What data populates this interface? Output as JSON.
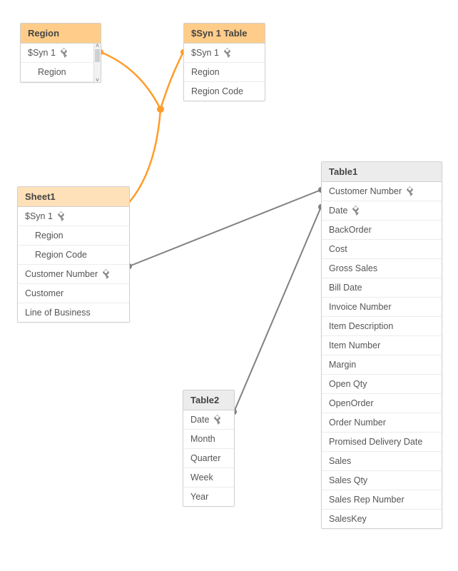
{
  "colors": {
    "orange_link": "#ff9c2a",
    "grey_link": "#808080",
    "header_orange": "#ffcd89",
    "header_orange_light": "#ffe1b9",
    "header_grey": "#ececec"
  },
  "nodes": {
    "region": {
      "title": "Region",
      "fields": [
        {
          "label": "$Syn 1",
          "key": true
        },
        {
          "label": "Region",
          "indent": true
        }
      ]
    },
    "syn1table": {
      "title": "$Syn 1 Table",
      "fields": [
        {
          "label": "$Syn 1",
          "key": true
        },
        {
          "label": "Region"
        },
        {
          "label": "Region Code"
        }
      ]
    },
    "sheet1": {
      "title": "Sheet1",
      "fields": [
        {
          "label": "$Syn 1",
          "key": true
        },
        {
          "label": "Region",
          "indent": true
        },
        {
          "label": "Region Code",
          "indent": true
        },
        {
          "label": "Customer Number",
          "key": true
        },
        {
          "label": "Customer"
        },
        {
          "label": "Line of Business"
        }
      ]
    },
    "table1": {
      "title": "Table1",
      "fields": [
        {
          "label": "Customer Number",
          "key": true
        },
        {
          "label": "Date",
          "key": true
        },
        {
          "label": "BackOrder"
        },
        {
          "label": "Cost"
        },
        {
          "label": "Gross Sales"
        },
        {
          "label": "Bill Date"
        },
        {
          "label": "Invoice Number"
        },
        {
          "label": "Item Description"
        },
        {
          "label": "Item Number"
        },
        {
          "label": "Margin"
        },
        {
          "label": "Open Qty"
        },
        {
          "label": "OpenOrder"
        },
        {
          "label": "Order Number"
        },
        {
          "label": "Promised Delivery Date"
        },
        {
          "label": "Sales"
        },
        {
          "label": "Sales Qty"
        },
        {
          "label": "Sales Rep Number"
        },
        {
          "label": "SalesKey"
        }
      ]
    },
    "table2": {
      "title": "Table2",
      "fields": [
        {
          "label": "Date",
          "key": true
        },
        {
          "label": "Month"
        },
        {
          "label": "Quarter"
        },
        {
          "label": "Week"
        },
        {
          "label": "Year"
        }
      ]
    }
  }
}
